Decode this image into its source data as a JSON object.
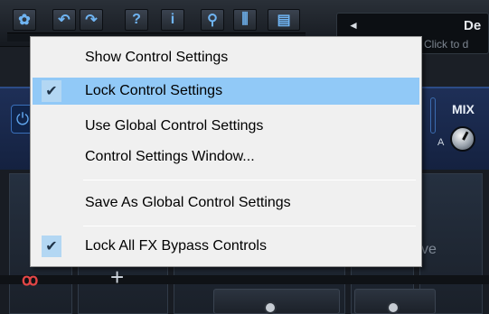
{
  "toolbar": {
    "buttons": [
      {
        "icon": "gear-icon",
        "glyph": "✿"
      },
      {
        "icon": "undo-icon",
        "glyph": "↶"
      },
      {
        "icon": "redo-icon",
        "glyph": "↷"
      },
      {
        "icon": "help-icon",
        "glyph": "?"
      },
      {
        "icon": "info-icon",
        "glyph": "i"
      },
      {
        "icon": "search-icon",
        "glyph": "⚲"
      },
      {
        "icon": "meter-icon",
        "glyph": "⫼"
      },
      {
        "icon": "keyboard-icon",
        "glyph": "▤"
      }
    ]
  },
  "preset": {
    "arrow": "◄",
    "name": "De",
    "hint": "Click to d"
  },
  "panel": {
    "power_glyph": "⏻",
    "mix_label": "MIX",
    "a_label": "A"
  },
  "rack": {
    "io_glyph": "ꝏ",
    "plus_glyph": "+",
    "partial_text": "ve"
  },
  "menu": {
    "items": [
      {
        "label": "Show Control Settings",
        "checked": false,
        "selected": false
      },
      {
        "label": "Lock Control Settings",
        "checked": true,
        "selected": true
      },
      {
        "label": "Use Global Control Settings",
        "checked": false,
        "selected": false
      },
      {
        "label": "Control Settings Window...",
        "checked": false,
        "selected": false
      },
      {
        "label": "Save As Global Control Settings",
        "checked": false,
        "selected": false
      },
      {
        "label": "Lock All FX Bypass Controls",
        "checked": true,
        "selected": false
      }
    ],
    "check_glyph": "✔"
  },
  "colors": {
    "menu_bg": "#f0f0f0",
    "menu_highlight": "#91c9f7",
    "accent_blue": "#6fb4f2",
    "panel_blue": "#1e2f57"
  }
}
